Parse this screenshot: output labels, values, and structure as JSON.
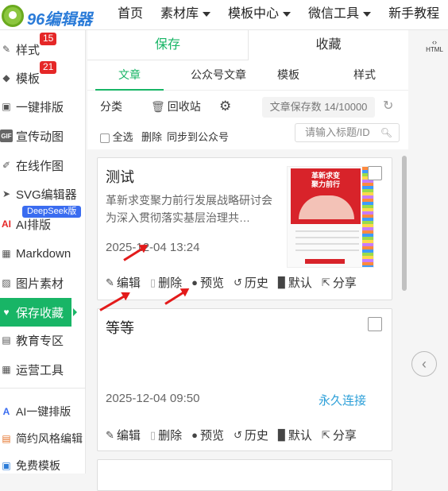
{
  "logo": {
    "text": "96编辑器"
  },
  "nav": {
    "items": [
      {
        "label": "首页"
      },
      {
        "label": "素材库"
      },
      {
        "label": "模板中心"
      },
      {
        "label": "微信工具"
      },
      {
        "label": "新手教程"
      }
    ]
  },
  "sidebar": {
    "items": [
      {
        "label": "样式",
        "icon": "brush-icon",
        "badge": "15"
      },
      {
        "label": "模板",
        "icon": "layers-icon",
        "badge": "21"
      },
      {
        "label": "一键排版",
        "icon": "copy-icon"
      },
      {
        "label": "宣传动图",
        "icon": "gif-icon"
      },
      {
        "label": "在线作图",
        "icon": "pencil-icon"
      },
      {
        "label": "SVG编辑器",
        "icon": "svg-icon"
      },
      {
        "label": "AI排版",
        "icon": "ai-icon",
        "badge": "DeepSeek版"
      },
      {
        "label": "Markdown",
        "icon": "markdown-icon"
      },
      {
        "label": "图片素材",
        "icon": "image-icon"
      },
      {
        "label": "保存收藏",
        "icon": "heart-icon"
      },
      {
        "label": "教育专区",
        "icon": "book-icon"
      },
      {
        "label": "运营工具",
        "icon": "grid-icon"
      },
      {
        "label": "AI一键排版",
        "icon": "ai-small-icon"
      },
      {
        "label": "简约风格编辑",
        "icon": "doc-icon"
      },
      {
        "label": "免费模板",
        "icon": "template-icon"
      }
    ]
  },
  "panel": {
    "tabs": [
      {
        "label": "保存"
      },
      {
        "label": "收藏"
      }
    ],
    "subtabs": [
      {
        "label": "文章"
      },
      {
        "label": "公众号文章"
      },
      {
        "label": "模板"
      },
      {
        "label": "样式"
      }
    ],
    "toolbar": {
      "category": "分类",
      "recycle": "回收站",
      "count": "文章保存数 14/10000"
    },
    "actions": {
      "select_all": "全选",
      "delete": "删除",
      "sync": "同步到公众号"
    },
    "search": {
      "placeholder": "请输入标题/ID"
    }
  },
  "cards": [
    {
      "title": "测试",
      "desc": "革新求变聚力前行发展战略研讨会为深入贯彻落实基层治理共…",
      "date": "2025-12-04 13:24",
      "actions": [
        "编辑",
        "删除",
        "预览",
        "历史",
        "默认",
        "分享"
      ],
      "thumb": {
        "heading": "革新求变\n聚力前行"
      }
    },
    {
      "title": "等等",
      "date": "2025-12-04 09:50",
      "link": "永久连接",
      "actions": [
        "编辑",
        "删除",
        "预览",
        "历史",
        "默认",
        "分享"
      ]
    }
  ],
  "right": {
    "html_label": "HTML"
  },
  "colors": {
    "accent": "#18b566",
    "badge": "#e52727",
    "link": "#2b9fd8"
  }
}
